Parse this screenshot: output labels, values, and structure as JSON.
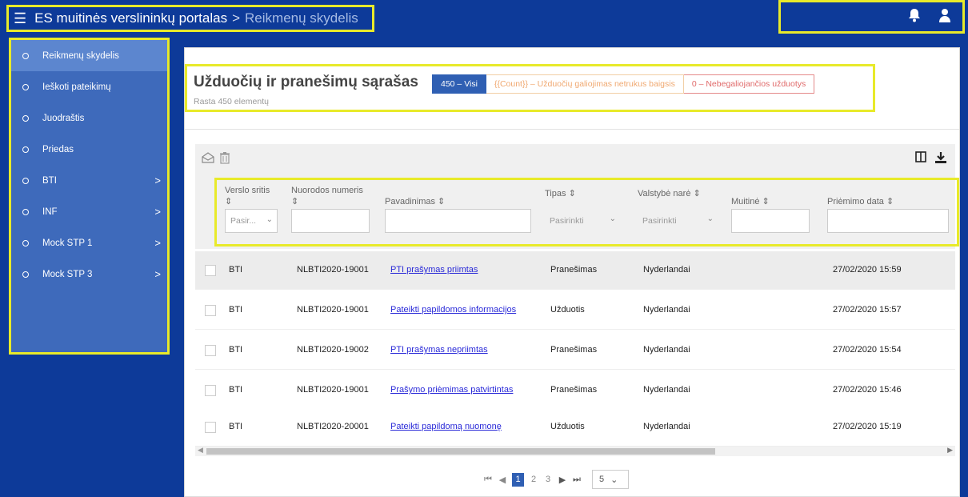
{
  "header": {
    "menu_icon": "hamburger-icon",
    "app_title": "ES muitinės verslininkų portalas",
    "separator": ">",
    "crumb": "Reikmenų skydelis",
    "bell_icon": "bell-icon",
    "user_icon": "user-icon"
  },
  "sidebar": {
    "items": [
      {
        "label": "Reikmenų skydelis",
        "active": true,
        "submenu": false
      },
      {
        "label": "Ieškoti pateikimų",
        "submenu": false
      },
      {
        "label": "Juodraštis",
        "submenu": false
      },
      {
        "label": "Priedas",
        "submenu": false
      },
      {
        "label": "BTI",
        "submenu": true
      },
      {
        "label": "INF",
        "submenu": true
      },
      {
        "label": "Mock STP 1",
        "submenu": true
      },
      {
        "label": "Mock STP 3",
        "submenu": true
      }
    ],
    "chevron": ">"
  },
  "main": {
    "title": "Užduočių ir pranešimų sąrašas",
    "subtitle": "Rasta 450 elementų",
    "chips": {
      "all": "450 – Visi",
      "soon": "{{Count}} – Užduočių galiojimas netrukus baigsis",
      "expired": "0 – Nebegaliojančios užduotys"
    }
  },
  "table": {
    "columns": {
      "sector": "Verslo sritis",
      "reference": "Nuorodos numeris",
      "name": "Pavadinimas",
      "type": "Tipas",
      "member_state": "Valstybė narė",
      "customs": "Muitinė",
      "received": "Priėmimo data"
    },
    "sort_mark": "⇕",
    "filters": {
      "sector_placeholder": "Pasir...",
      "type_placeholder": "Pasirinkti",
      "state_placeholder": "Pasirinkti"
    },
    "rows": [
      {
        "sector": "BTI",
        "ref": "NLBTI2020-19001",
        "name": "PTI prašymas priimtas",
        "type": "Pranešimas",
        "state": "Nyderlandai",
        "date": "27/02/2020 15:59"
      },
      {
        "sector": "BTI",
        "ref": "NLBTI2020-19001",
        "name": "Pateikti papildomos informacijos",
        "type": "Užduotis",
        "state": "Nyderlandai",
        "date": "27/02/2020 15:57"
      },
      {
        "sector": "BTI",
        "ref": "NLBTI2020-19002",
        "name": "PTI prašymas nepriimtas",
        "type": "Pranešimas",
        "state": "Nyderlandai",
        "date": "27/02/2020 15:54"
      },
      {
        "sector": "BTI",
        "ref": "NLBTI2020-19001",
        "name": "Prašymo priėmimas patvirtintas",
        "type": "Pranešimas",
        "state": "Nyderlandai",
        "date": "27/02/2020 15:46"
      },
      {
        "sector": "BTI",
        "ref": "NLBTI2020-20001",
        "name": "Pateikti papildomą nuomonę",
        "type": "Užduotis",
        "state": "Nyderlandai",
        "date": "27/02/2020 15:19"
      }
    ]
  },
  "pagination": {
    "first": "⏮",
    "prev": "◀",
    "pages": [
      "1",
      "2",
      "3"
    ],
    "current": "1",
    "next": "▶",
    "last": "⏭",
    "page_size": "5"
  }
}
